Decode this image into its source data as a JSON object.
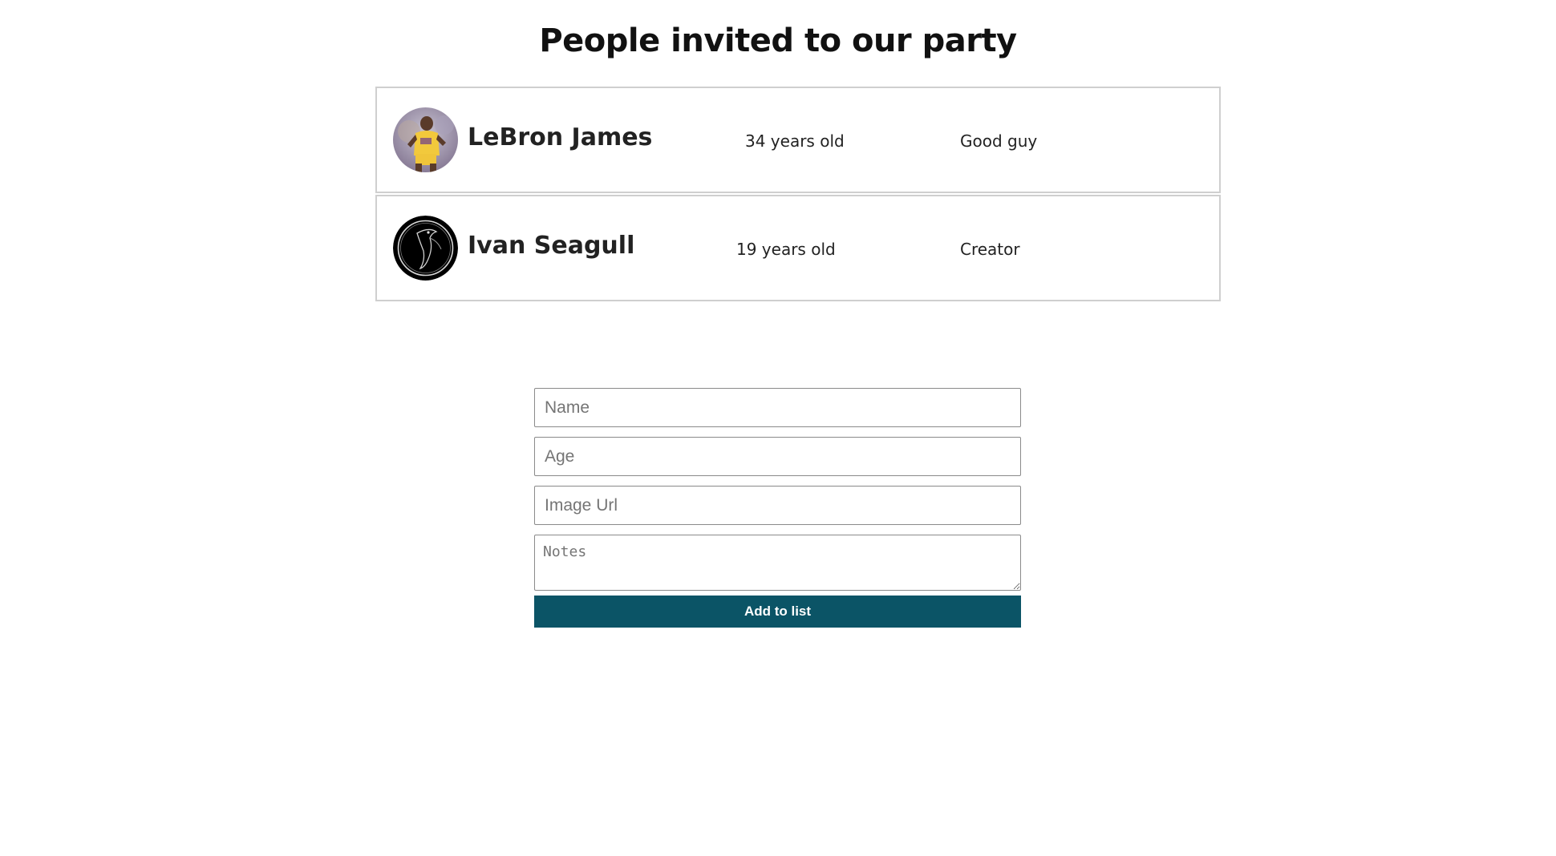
{
  "page": {
    "title": "People invited to our party"
  },
  "guests": [
    {
      "name": "LeBron James",
      "age": "34 years old",
      "note": "Good guy",
      "avatar_icon": "basketball-player-photo"
    },
    {
      "name": "Ivan Seagull",
      "age": "19 years old",
      "note": "Creator",
      "avatar_icon": "seagull-logo"
    }
  ],
  "form": {
    "name_placeholder": "Name",
    "age_placeholder": "Age",
    "image_url_placeholder": "Image Url",
    "notes_placeholder": "Notes",
    "submit_label": "Add to list"
  },
  "colors": {
    "button": "#0b5466",
    "card_border": "#cfcfcf"
  }
}
